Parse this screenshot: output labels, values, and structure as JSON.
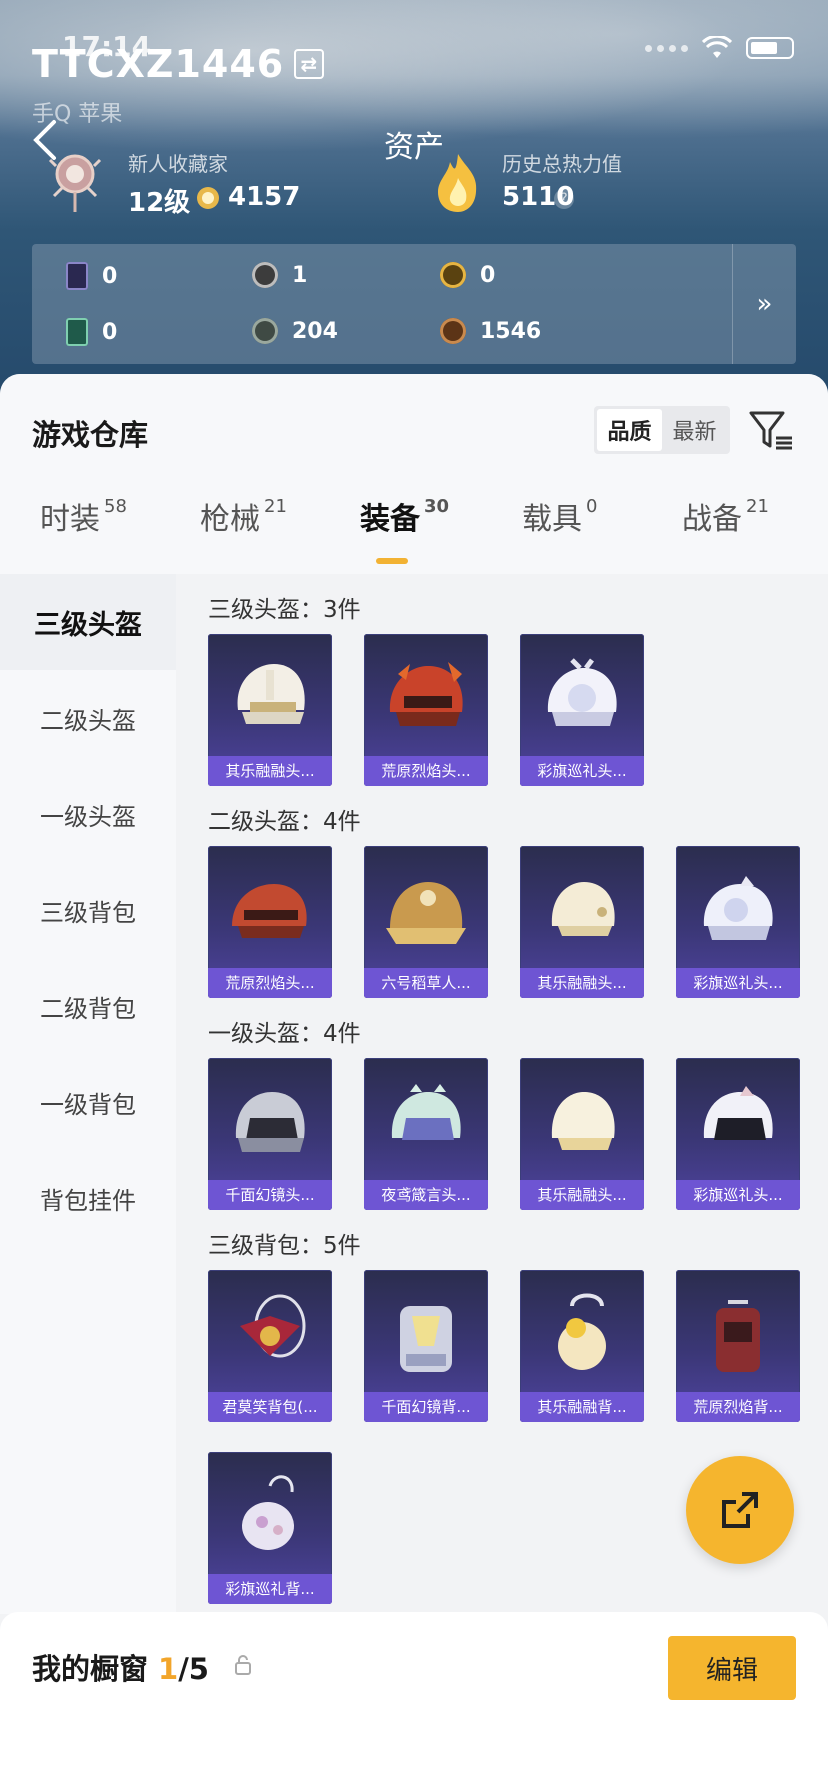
{
  "status_bar": {
    "time": "17:14"
  },
  "header": {
    "username": "TTCXZ1446",
    "platform": "手Q 苹果",
    "title": "资产",
    "collector_label": "新人收藏家",
    "level": "12级",
    "coins": "4157",
    "heat_label": "历史总热力值",
    "heat_value": "5110",
    "help": "?"
  },
  "currencies": [
    {
      "value": "0",
      "icon": "purple-card-icon"
    },
    {
      "value": "1",
      "icon": "silver-token-icon"
    },
    {
      "value": "0",
      "icon": "gold-token-icon"
    },
    {
      "value": "0",
      "icon": "green-card-icon"
    },
    {
      "value": "204",
      "icon": "gray-orb-icon"
    },
    {
      "value": "1546",
      "icon": "bronze-orb-icon"
    }
  ],
  "warehouse": {
    "title": "游戏仓库",
    "sort_options": [
      "品质",
      "最新"
    ],
    "sort_active": "品质"
  },
  "tabs": [
    {
      "label": "时装",
      "count": "58"
    },
    {
      "label": "枪械",
      "count": "21"
    },
    {
      "label": "装备",
      "count": "30",
      "active": true
    },
    {
      "label": "载具",
      "count": "0"
    },
    {
      "label": "战备",
      "count": "21"
    }
  ],
  "sidebar": [
    "三级头盔",
    "二级头盔",
    "一级头盔",
    "三级背包",
    "二级背包",
    "一级背包",
    "背包挂件"
  ],
  "groups": [
    {
      "title": "三级头盔：3件",
      "items": [
        "其乐融融头...",
        "荒原烈焰头...",
        "彩旗巡礼头..."
      ]
    },
    {
      "title": "二级头盔：4件",
      "items": [
        "荒原烈焰头...",
        "六号稻草人...",
        "其乐融融头...",
        "彩旗巡礼头..."
      ]
    },
    {
      "title": "一级头盔：4件",
      "items": [
        "千面幻镜头...",
        "夜鸢箴言头...",
        "其乐融融头...",
        "彩旗巡礼头..."
      ]
    },
    {
      "title": "三级背包：5件",
      "items": [
        "君莫笑背包(...",
        "千面幻镜背...",
        "其乐融融背...",
        "荒原烈焰背...",
        "彩旗巡礼背..."
      ]
    }
  ],
  "showcase": {
    "label": "我的橱窗",
    "current": "1",
    "total": "/5"
  },
  "edit_label": "编辑",
  "colors": {
    "accent": "#f5b52e",
    "item_bg": "#3b3777",
    "item_label_bg": "#6e55d3"
  }
}
